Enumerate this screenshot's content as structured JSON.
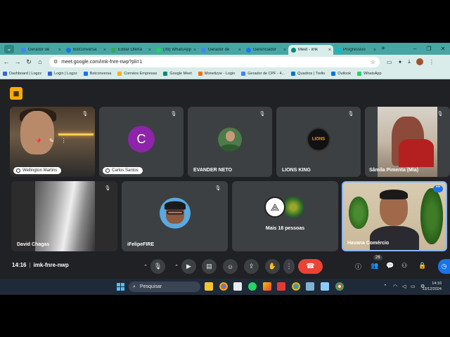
{
  "browser": {
    "tabs": [
      {
        "label": "Gerador de",
        "color": "#4285f4",
        "active": false
      },
      {
        "label": "Botconversa",
        "color": "#1a73e8",
        "active": false
      },
      {
        "label": "Editar Oferta",
        "color": "#34a853",
        "active": false
      },
      {
        "label": "(39) WhatsApp",
        "color": "#25d366",
        "active": false
      },
      {
        "label": "Gerador de",
        "color": "#4285f4",
        "active": false
      },
      {
        "label": "Gerenciador",
        "color": "#1877f2",
        "active": false
      },
      {
        "label": "Meet - imk",
        "color": "#00897b",
        "active": true
      },
      {
        "label": "Progressivo",
        "color": "#00bcd4",
        "active": false
      }
    ],
    "url": "meet.google.com/imk-fnre-nwp?pli=1",
    "bookmarks": [
      {
        "label": "Dashboard | Logzz",
        "color": "#3367d6"
      },
      {
        "label": "Login | Logzz",
        "color": "#3367d6"
      },
      {
        "label": "Botconversa",
        "color": "#1a73e8"
      },
      {
        "label": "Correios Empresas",
        "color": "#f4b400"
      },
      {
        "label": "Google Meet",
        "color": "#00897b"
      },
      {
        "label": "Monetizze - Login",
        "color": "#ff6d00"
      },
      {
        "label": "Gerador de CPF - 4...",
        "color": "#4285f4"
      },
      {
        "label": "Quadros | Trello",
        "color": "#0079bf"
      },
      {
        "label": "Outlook",
        "color": "#0078d4"
      },
      {
        "label": "WhatsApp",
        "color": "#25d366"
      }
    ]
  },
  "meet": {
    "participants": {
      "wellington": "Wellington Martins",
      "carlos": "Carlos Santos",
      "carlos_initial": "C",
      "evander": "EVANDER NETO",
      "lions": "LIONS KING",
      "lions_logo": "LIONS",
      "samila": "Sâmila Pimenta (Mia)",
      "david": "David Chagas",
      "ifelipe": "iFelipeFIRE",
      "more": "Mais 18 pessoas",
      "havana": "Havana Comércio"
    },
    "time": "14:16",
    "meeting_code": "imk-fnre-nwp",
    "participant_count": "26"
  },
  "taskbar": {
    "search_placeholder": "Pesquisar",
    "time": "14:16",
    "date": "13/12/2024"
  }
}
